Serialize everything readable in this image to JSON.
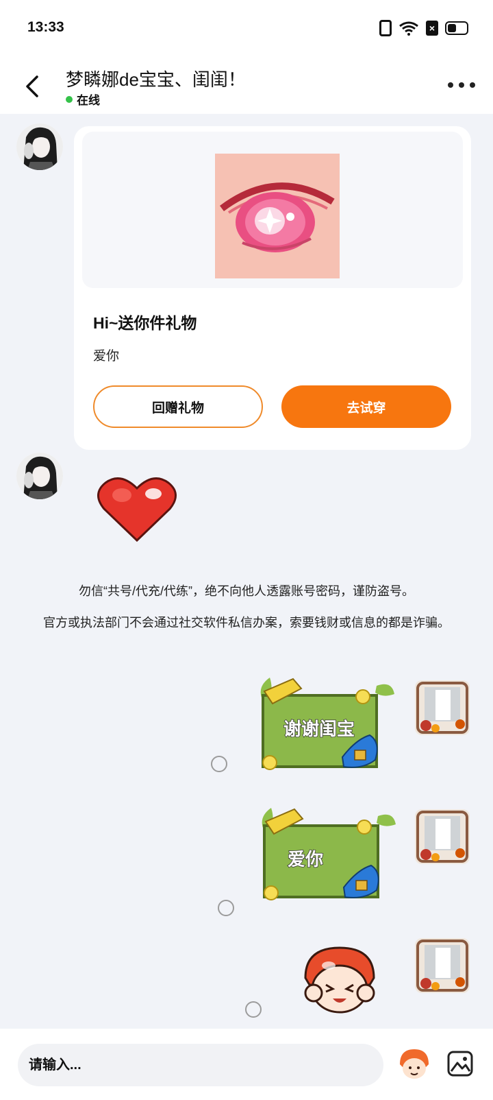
{
  "status_bar": {
    "time": "13:33",
    "icons": [
      "vibrate-icon",
      "wifi-icon",
      "sim-off-icon",
      "battery-icon"
    ]
  },
  "header": {
    "title": "梦瞵娜de宝宝、闺闺！",
    "status": "在线",
    "status_color": "#35c24a"
  },
  "gift_card": {
    "title": "Hi~送你件礼物",
    "message": "爱你",
    "return_button": "回赠礼物",
    "try_button": "去试穿",
    "accent": "#f7760f"
  },
  "notice": {
    "line1": "勿信“共号/代充/代练”，绝不向他人透露账号密码，谨防盗号。",
    "line2": "官方或执法部门不会通过社交软件私信办案，索要钱财或信息的都是诈骗。"
  },
  "messages": [
    {
      "sender": "self",
      "type": "sticker",
      "text": "谢谢闺宝"
    },
    {
      "sender": "self",
      "type": "sticker",
      "text": "爱你"
    },
    {
      "sender": "self",
      "type": "sticker",
      "text": ""
    }
  ],
  "input": {
    "placeholder": "请输入..."
  }
}
